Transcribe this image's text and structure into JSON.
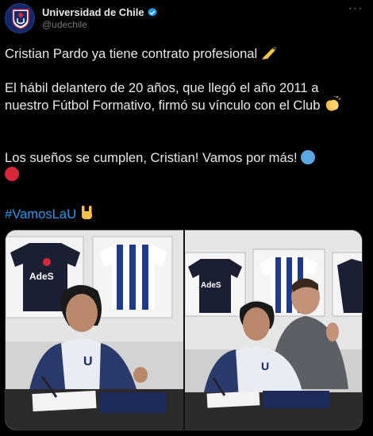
{
  "account": {
    "display_name": "Universidad de Chile",
    "handle": "@udechile",
    "avatar_icon": "club-crest-icon",
    "verified_icon": "verified-badge-icon",
    "more_icon": "more-options-icon"
  },
  "tweet": {
    "line1": "Cristian Pardo ya tiene contrato profesional",
    "line2": "El hábil delantero de 20 años, que llegó el año 2011 a nuestro Fútbol Formativo, firmó su vínculo con el Club",
    "line3": "Los sueños se cumplen, Cristian! Vamos por más!",
    "hashtag": "#VamosLaU",
    "emoji": {
      "writing_hand": "✍️",
      "clapping": "👏",
      "rock_on": "🤘"
    }
  },
  "media": {
    "photo_count": 2,
    "shirt_sponsor": "AdeS",
    "shirt_sponsor_dup": "AdeS"
  },
  "colors": {
    "background": "#000000",
    "text": "#e7e9ea",
    "muted": "#71767b",
    "link": "#1d9bf0",
    "verified": "#1d9bf0",
    "club_blue": "#13286b",
    "club_red": "#d9263b"
  }
}
